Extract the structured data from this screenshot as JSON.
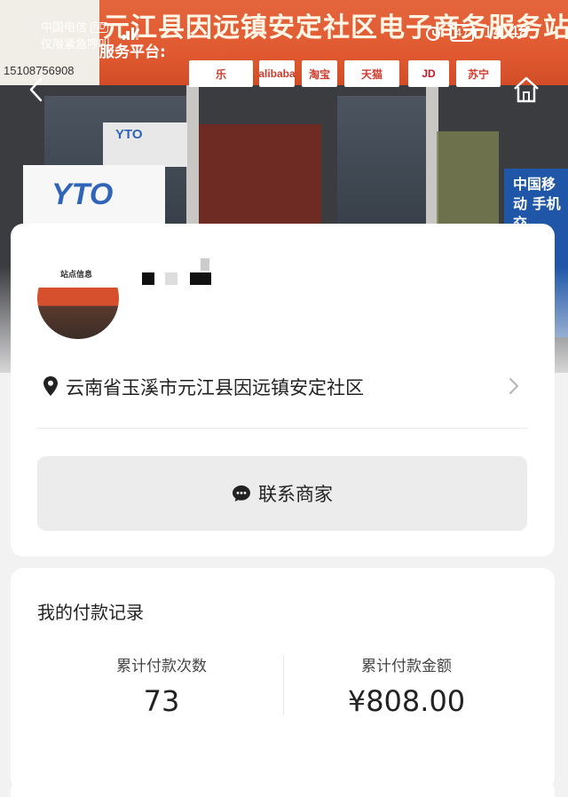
{
  "status_bar": {
    "carrier": "中国电信",
    "hd": "HD",
    "network": "5G",
    "emergency": "仅限紧急呼叫",
    "battery": "47",
    "time": "14:48"
  },
  "photo_sign": {
    "title": "元江县因远镇安定社区电子商务服务站",
    "subtitle": "服务平台:",
    "phone": "15108756908",
    "yt_logo": "YTO",
    "mobile_board": "中国移动 手机交"
  },
  "store": {
    "avatar_label": "站点信息",
    "address": "云南省玉溪市元江县因远镇安定社区"
  },
  "contact_button": {
    "label": "联系商家"
  },
  "payment": {
    "title": "我的付款记录",
    "count_label": "累计付款次数",
    "count_value": "73",
    "amount_label": "累计付款金额",
    "amount_value": "¥808.00"
  },
  "colors": {
    "sign_orange": "#e15a31",
    "card_bg": "#ffffff",
    "button_bg": "#ececec"
  }
}
